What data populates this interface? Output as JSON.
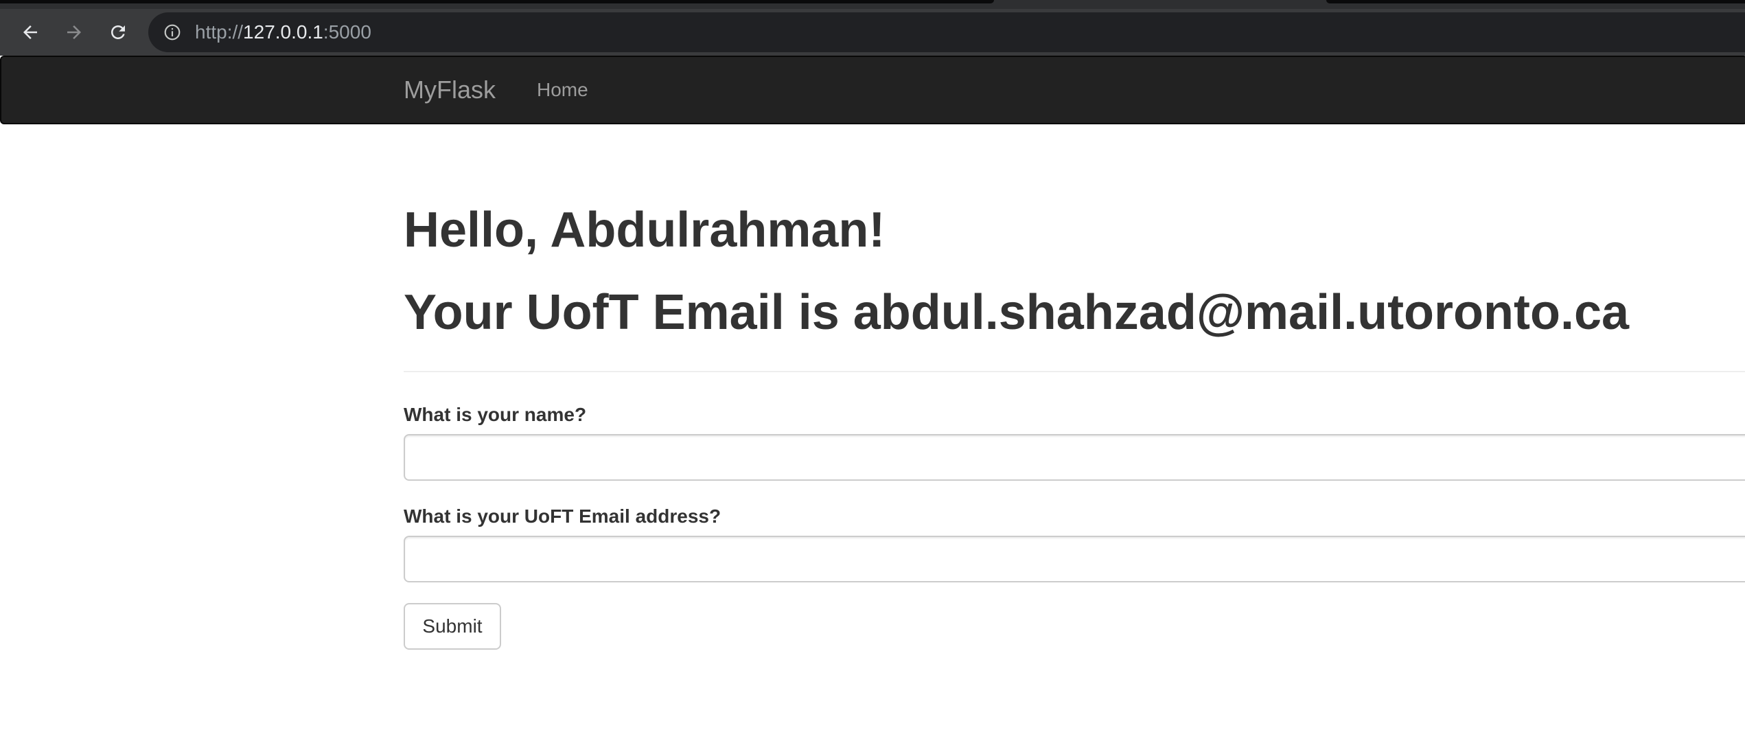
{
  "browser": {
    "url_scheme": "http://",
    "url_host": "127.0.0.1",
    "url_port": ":5000",
    "icons": {
      "back": "arrow-left-icon",
      "forward": "arrow-right-icon",
      "reload": "reload-icon",
      "site_info": "info-icon"
    },
    "colors": {
      "chrome_dark": "#3a3b3d",
      "omnibox": "#202124"
    }
  },
  "navbar": {
    "brand": "MyFlask",
    "links": [
      {
        "label": "Home"
      }
    ],
    "colors": {
      "background": "#222222",
      "text": "#9d9d9d"
    }
  },
  "page": {
    "greeting": "Hello, Abdulrahman!",
    "email_heading": "Your UofT Email is abdul.shahzad@mail.utoronto.ca"
  },
  "form": {
    "name_label": "What is your name?",
    "name_value": "",
    "email_label": "What is your UoFT Email address?",
    "email_value": "",
    "submit_label": "Submit"
  }
}
